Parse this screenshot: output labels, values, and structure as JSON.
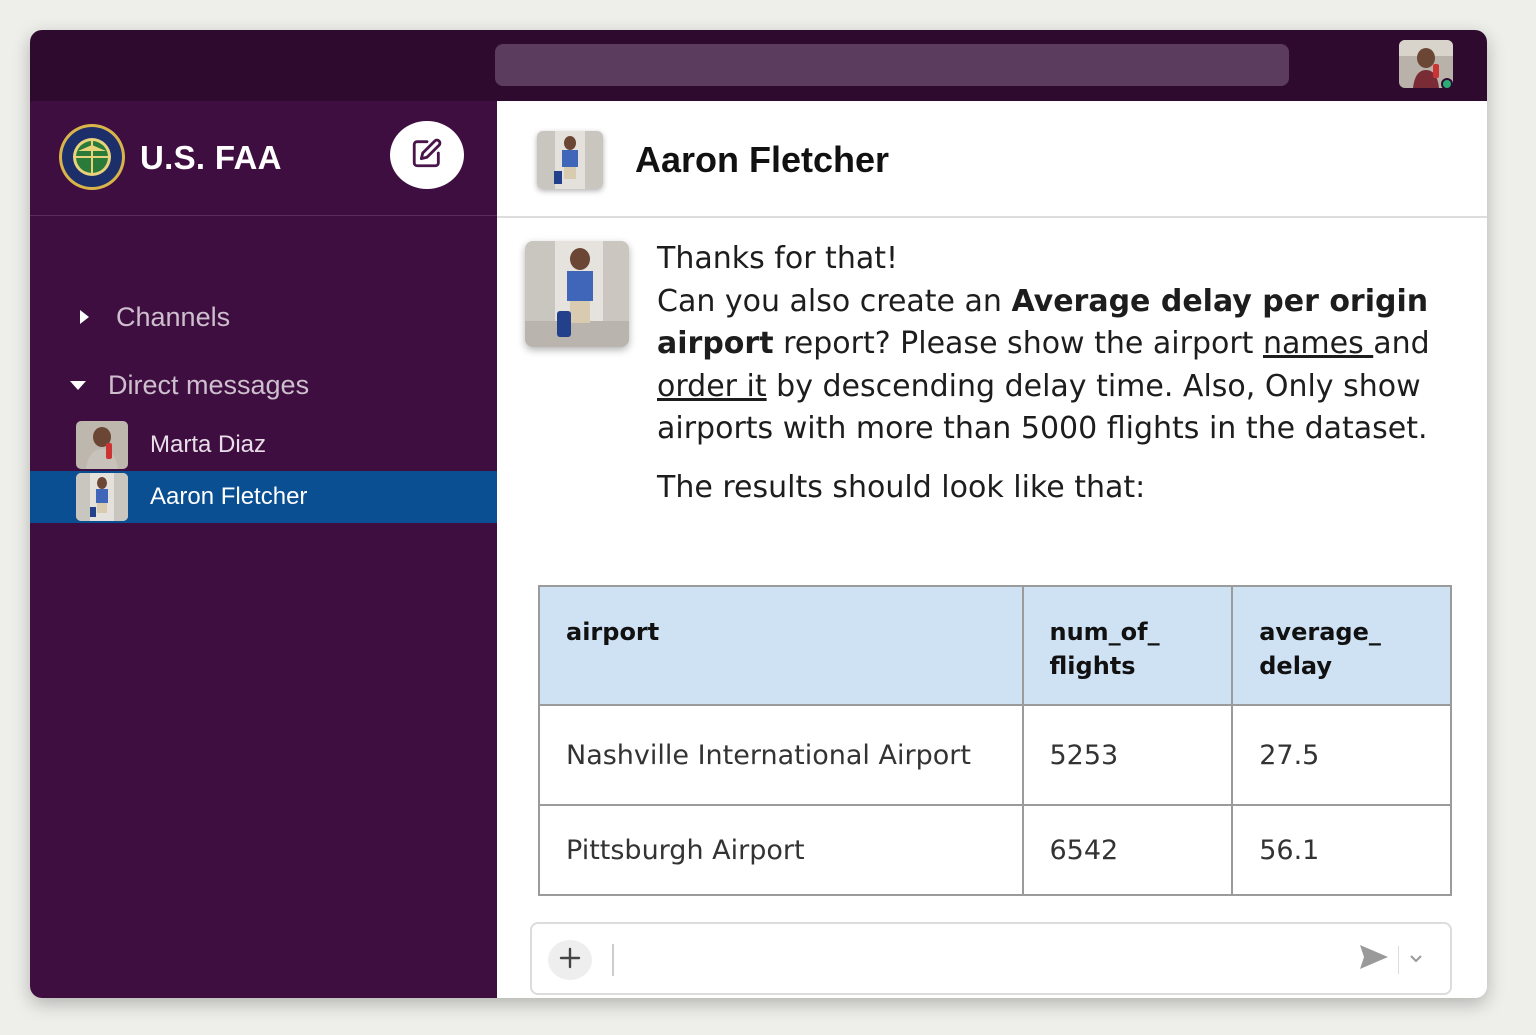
{
  "workspace": {
    "name": "U.S. FAA",
    "logo_icon": "faa-seal-icon",
    "compose_icon": "edit-icon"
  },
  "sidebar": {
    "sections": [
      {
        "label": "Channels",
        "expanded": false
      },
      {
        "label": "Direct messages",
        "expanded": true
      }
    ],
    "direct_messages": [
      {
        "name": "Marta Diaz",
        "active": false
      },
      {
        "name": "Aaron Fletcher",
        "active": true
      }
    ]
  },
  "channel": {
    "title": "Aaron Fletcher"
  },
  "message": {
    "line_1": "Thanks for that!",
    "p_a": "Can you also create an ",
    "p_bold": "Average delay per origin airport",
    "p_b": " report? Please show the airport ",
    "p_u1": "names ",
    "p_c": "and ",
    "p_u2": "order it",
    "p_d": " by descending delay time. Also, Only show airports with more than 5000 flights in the dataset.",
    "results_line": "The results should look like that:"
  },
  "table": {
    "headers": [
      "airport",
      "num_of_\nflights",
      "average_\ndelay"
    ],
    "rows": [
      [
        "Nashville International Airport",
        "5253",
        "27.5"
      ],
      [
        "Pittsburgh Airport",
        "6542",
        "56.1"
      ]
    ]
  },
  "colors": {
    "topbar": "#2e0b2e",
    "sidebar": "#3f0e40",
    "active_item": "#0b4f93",
    "table_header": "#cfe2f3"
  }
}
